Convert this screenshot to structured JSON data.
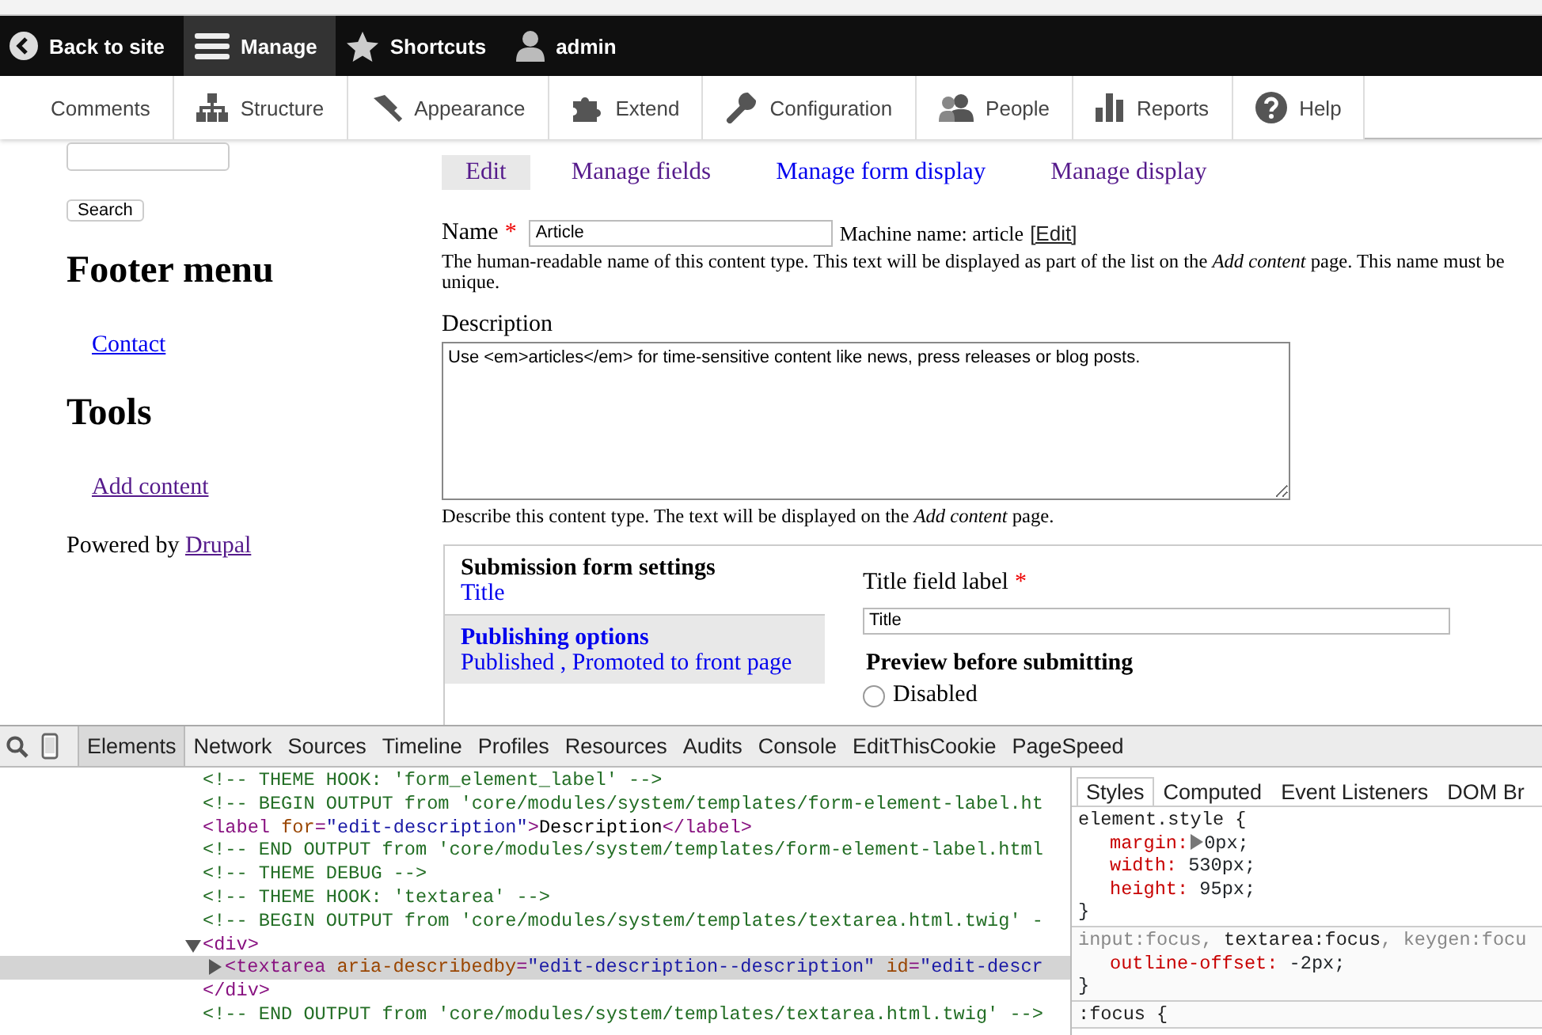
{
  "toolbar": {
    "items": [
      {
        "label": "Back to site",
        "selected": false
      },
      {
        "label": "Manage",
        "selected": true
      },
      {
        "label": "Shortcuts",
        "selected": false
      },
      {
        "label": "admin",
        "selected": false
      }
    ]
  },
  "tray": {
    "items": [
      {
        "label": "Comments"
      },
      {
        "label": "Structure"
      },
      {
        "label": "Appearance"
      },
      {
        "label": "Extend"
      },
      {
        "label": "Configuration"
      },
      {
        "label": "People"
      },
      {
        "label": "Reports"
      },
      {
        "label": "Help"
      }
    ]
  },
  "sidebar": {
    "search_button": "Search",
    "blocks": [
      {
        "title": "Footer menu",
        "links": [
          {
            "label": "Contact",
            "visited": false
          }
        ]
      },
      {
        "title": "Tools",
        "links": [
          {
            "label": "Add content",
            "visited": true
          }
        ]
      }
    ],
    "powered_by": {
      "text": "Powered by",
      "link": "Drupal",
      "visited": true
    }
  },
  "tabs": [
    {
      "label": "Edit",
      "selected": true,
      "visited": true
    },
    {
      "label": "Manage fields",
      "selected": false,
      "visited": true
    },
    {
      "label": "Manage form display",
      "selected": false,
      "visited": false
    },
    {
      "label": "Manage display",
      "selected": false,
      "visited": true
    }
  ],
  "form": {
    "name": {
      "label": "Name",
      "required_mark": "*",
      "value": "Article",
      "machine_name": "Machine name: article",
      "machine_edit": "[Edit]",
      "help": "The human-readable name of this content type. This text will be displayed as part of the list on the *Add content* page. This name must be unique."
    },
    "description": {
      "label": "Description",
      "value": "Use <em>articles</em> for time-sensitive content like news, press releases or blog posts.",
      "help": "Describe this content type. The text will be displayed on the *Add content* page."
    },
    "vertical_tabs": [
      {
        "title": "Submission form settings",
        "summary": "Title",
        "selected": true
      },
      {
        "title": "Publishing options",
        "summary": "Published , Promoted to front page",
        "selected": false
      }
    ],
    "pane": {
      "field_label": "Title field label",
      "required_mark": "*",
      "field_value": "Title",
      "section": "Preview before submitting",
      "options": [
        {
          "label": "Disabled",
          "selected": false
        }
      ]
    }
  },
  "devtools": {
    "tabs": [
      {
        "label": "Elements",
        "selected": true
      },
      {
        "label": "Network",
        "selected": false
      },
      {
        "label": "Sources",
        "selected": false
      },
      {
        "label": "Timeline",
        "selected": false
      },
      {
        "label": "Profiles",
        "selected": false
      },
      {
        "label": "Resources",
        "selected": false
      },
      {
        "label": "Audits",
        "selected": false
      },
      {
        "label": "Console",
        "selected": false
      },
      {
        "label": "EditThisCookie",
        "selected": false
      },
      {
        "label": "PageSpeed",
        "selected": false
      }
    ],
    "lines": [
      {
        "selected": false,
        "segments": [
          {
            "kind": "comment",
            "text": "<!-- THEME HOOK: 'form_element_label' -->"
          }
        ]
      },
      {
        "selected": false,
        "segments": [
          {
            "kind": "comment",
            "text": "<!-- BEGIN OUTPUT from 'core/modules/system/templates/form-element-label.ht"
          }
        ]
      },
      {
        "selected": false,
        "segments": [
          {
            "kind": "tag",
            "text": "<label "
          },
          {
            "kind": "attr",
            "text": "for"
          },
          {
            "kind": "tag",
            "text": "="
          },
          {
            "kind": "value",
            "text": "\"edit-description\""
          },
          {
            "kind": "tag",
            "text": ">"
          },
          {
            "kind": "text",
            "text": "Description"
          },
          {
            "kind": "tag",
            "text": "</label>"
          }
        ]
      },
      {
        "selected": false,
        "segments": [
          {
            "kind": "comment",
            "text": "<!-- END OUTPUT from 'core/modules/system/templates/form-element-label.html"
          }
        ]
      },
      {
        "selected": false,
        "segments": [
          {
            "kind": "comment",
            "text": "<!-- THEME DEBUG -->"
          }
        ]
      },
      {
        "selected": false,
        "segments": [
          {
            "kind": "comment",
            "text": "<!-- THEME HOOK: 'textarea' -->"
          }
        ]
      },
      {
        "selected": false,
        "segments": [
          {
            "kind": "comment",
            "text": "<!-- BEGIN OUTPUT from 'core/modules/system/templates/textarea.html.twig' -"
          }
        ]
      },
      {
        "selected": false,
        "expanded": true,
        "segments": [
          {
            "kind": "tag",
            "text": "<div>"
          }
        ]
      },
      {
        "selected": true,
        "expanded": false,
        "segments": [
          {
            "kind": "tag",
            "text": "<textarea "
          },
          {
            "kind": "attr",
            "text": "aria-describedby"
          },
          {
            "kind": "tag",
            "text": "="
          },
          {
            "kind": "value",
            "text": "\"edit-description--description\" "
          },
          {
            "kind": "attr",
            "text": "id"
          },
          {
            "kind": "tag",
            "text": "="
          },
          {
            "kind": "value",
            "text": "\"edit-descr"
          }
        ]
      },
      {
        "selected": false,
        "segments": [
          {
            "kind": "tag",
            "text": "</div>"
          }
        ]
      },
      {
        "selected": false,
        "segments": [
          {
            "kind": "comment",
            "text": "<!-- END OUTPUT from 'core/modules/system/templates/textarea.html.twig' -->"
          }
        ]
      }
    ],
    "style_tabs": [
      {
        "label": "Styles",
        "selected": true
      },
      {
        "label": "Computed",
        "selected": false
      },
      {
        "label": "Event Listeners",
        "selected": false
      },
      {
        "label": "DOM Br",
        "selected": false
      }
    ],
    "rules": [
      {
        "selectors": [
          {
            "text": "element.style {",
            "matched": true
          }
        ],
        "declarations": [
          {
            "property": "margin:",
            "value": "0px;",
            "expandable": true
          },
          {
            "property": "width:",
            "value": "530px;",
            "expandable": false
          },
          {
            "property": "height:",
            "value": "95px;",
            "expandable": false
          }
        ],
        "close": "}"
      },
      {
        "selectors": [
          {
            "text": "input:focus, ",
            "matched": false
          },
          {
            "text": "textarea:focus",
            "matched": true
          },
          {
            "text": ", keygen:focu",
            "matched": false
          }
        ],
        "declarations": [
          {
            "property": "outline-offset:",
            "value": "-2px;",
            "expandable": false
          }
        ],
        "close": "}"
      },
      {
        "selectors": [
          {
            "text": ":focus {",
            "matched": true
          }
        ]
      }
    ]
  }
}
